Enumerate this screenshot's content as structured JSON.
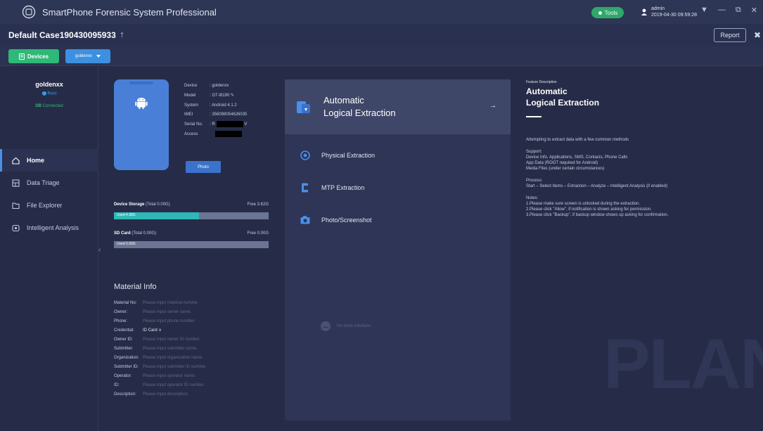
{
  "titlebar": {
    "app_title": "SmartPhone Forensic System Professional",
    "tools_label": "Tools",
    "user_name": "admin",
    "user_time": "2019-04-30 09:59:28",
    "controls": [
      "▼",
      "—",
      "⧉",
      "✕"
    ]
  },
  "case": {
    "title": "Default Case190430095933",
    "flag": "†",
    "report_label": "Report",
    "close_glyph": "✖"
  },
  "devicebar": {
    "devices_label": "Devices",
    "selected_device": "goldenxx"
  },
  "sidebar": {
    "device_name": "goldenxx",
    "root_status": "Root",
    "connection_status": "Connected",
    "connection_prefix": "DB",
    "nav": [
      {
        "label": "Home",
        "icon": "home-icon",
        "active": true
      },
      {
        "label": "Data Triage",
        "icon": "triage-icon",
        "active": false
      },
      {
        "label": "File Explorer",
        "icon": "folder-icon",
        "active": false
      },
      {
        "label": "Intelligent Analysis",
        "icon": "analysis-icon",
        "active": false
      }
    ],
    "collapse_glyph": "‹"
  },
  "device_info": {
    "rows": [
      {
        "key": "Device",
        "value": ": goldenxx"
      },
      {
        "key": "Model",
        "value": ": GT-I8190 ✎"
      },
      {
        "key": "System",
        "value": ": Android 4.1.2"
      },
      {
        "key": "IMEI",
        "value": ": 356098054626035"
      },
      {
        "key": "Serial No.",
        "value": ": R"
      },
      {
        "key": "Access",
        "value": ""
      }
    ],
    "photo_button": "Photo"
  },
  "storage": {
    "device": {
      "label": "Device Storage",
      "total": "(Total 0.00G)",
      "free": "Free 3.62G",
      "used": "Used 4.38G",
      "fill_fraction": 0.55
    },
    "sd": {
      "label": "SD Card",
      "total": "(Total 0.00G)",
      "free": "Free 0.00G",
      "used": "Used 0.00G",
      "fill_fraction": 0.0
    }
  },
  "material": {
    "title": "Material Info",
    "rows": [
      {
        "key": "Material No:",
        "value": "Please input material number.",
        "filled": false
      },
      {
        "key": "Owner:",
        "value": "Please input owner name.",
        "filled": false
      },
      {
        "key": "Phone:",
        "value": "Please input phone number.",
        "filled": false
      },
      {
        "key": "Credential:",
        "value": "ID Card ∨",
        "filled": true
      },
      {
        "key": "Owner ID:",
        "value": "Please input owner ID number.",
        "filled": false
      },
      {
        "key": "Submitter:",
        "value": "Please input submitter name.",
        "filled": false
      },
      {
        "key": "Organization:",
        "value": "Please input organization name.",
        "filled": false
      },
      {
        "key": "Submitter ID:",
        "value": "Please input submitter ID number.",
        "filled": false
      },
      {
        "key": "Operator:",
        "value": "Please input operator name.",
        "filled": false
      },
      {
        "key": "ID:",
        "value": "Please input operator ID number.",
        "filled": false
      },
      {
        "key": "Description:",
        "value": "Please input description.",
        "filled": false
      }
    ]
  },
  "methods": {
    "main": {
      "line1": "Automatic",
      "line2": "Logical Extraction",
      "arrow": "→"
    },
    "others": [
      {
        "label": "Physical Extraction",
        "icon": "chip-icon"
      },
      {
        "label": "MTP Extraction",
        "icon": "phone-transfer-icon"
      },
      {
        "label": "Photo/Screenshot",
        "icon": "camera-icon"
      }
    ],
    "no_more": "No more solutions."
  },
  "description": {
    "kicker": "Feature Description",
    "title_line1": "Automatic",
    "title_line2": "Logical Extraction",
    "intro": "Attempting to extract data with a few common methods",
    "support_title": "Support:",
    "support_lines": [
      "Device Info, Applications, SMS, Contacts, Phone Calls",
      "App Data (ROOT required for Android)",
      "Media Files (under certain circumstances)"
    ],
    "process_title": "Process:",
    "process_line": "Start – Select Items – Extraction – Analyze – Intelligent Analysis (if enabled)",
    "notes_title": "Notes:",
    "notes_lines": [
      "1.Please make sure screen is unlocked during the extraction.",
      "2.Please click \"Allow\", if notification is shown asking for permission.",
      "3.Please click \"Backup\", if backup window shows up asking for confirmation."
    ],
    "watermark": "PLAN"
  },
  "colors": {
    "accent_green": "#2fb878",
    "accent_blue": "#3d8fe0",
    "storage_fill": "#2fb8b8",
    "background": "#262c47"
  }
}
